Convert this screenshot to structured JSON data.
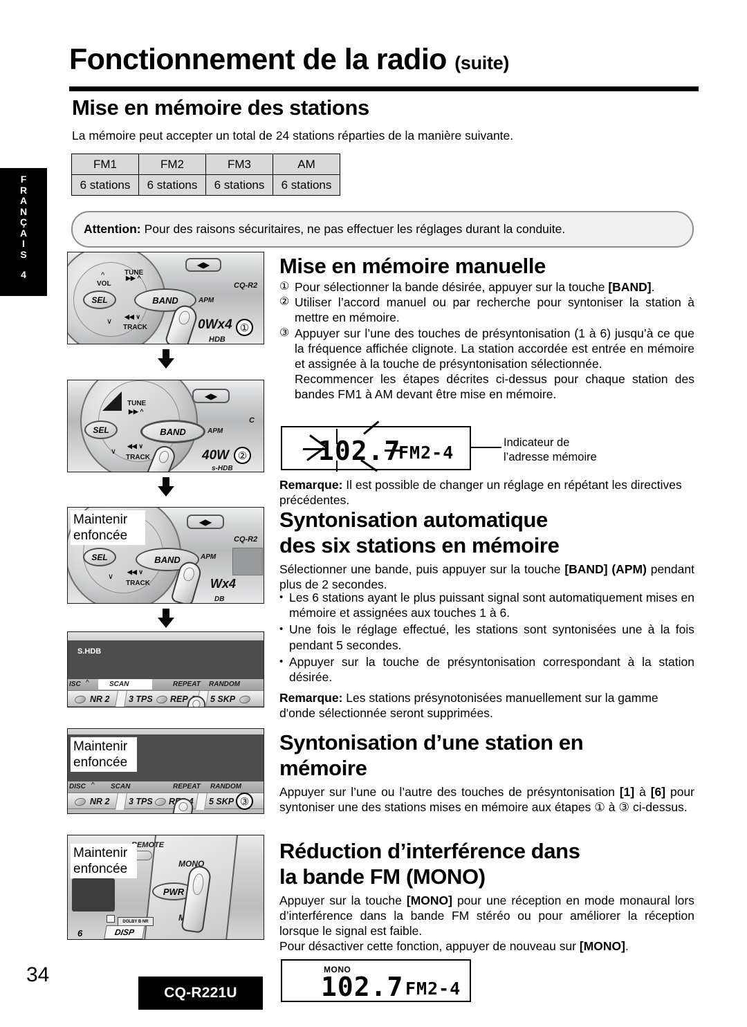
{
  "side_tab": {
    "letters": [
      "F",
      "R",
      "A",
      "N",
      "Ç",
      "A",
      "I",
      "S"
    ],
    "number": "4"
  },
  "header": {
    "title_main": "Fonctionnement de la radio",
    "title_suffix": "(suite)"
  },
  "sections": {
    "stations_memory": {
      "heading": "Mise en mémoire des stations",
      "intro": "La mémoire peut accepter un total de 24 stations réparties de la manière suivante.",
      "table": {
        "headers": [
          "FM1",
          "FM2",
          "FM3",
          "AM"
        ],
        "row": [
          "6 stations",
          "6 stations",
          "6 stations",
          "6 stations"
        ]
      },
      "attention_label": "Attention:",
      "attention_text": "Pour des raisons sécuritaires, ne pas effectuer les réglages durant la conduite."
    },
    "manual_memory": {
      "heading": "Mise en mémoire manuelle",
      "steps": [
        {
          "mark": "①",
          "text_pre": "Pour sélectionner la bande désirée, appuyer sur la touche ",
          "bold": "[BAND]",
          "text_post": "."
        },
        {
          "mark": "②",
          "text_pre": "Utiliser l’accord manuel ou par recherche pour syntoniser la station à mettre en mémoire.",
          "bold": "",
          "text_post": ""
        },
        {
          "mark": "③",
          "text_pre": "Appuyer sur l’une des touches de présyntonisation  (1 à 6) jusqu’à ce que la fréquence affichée clignote. La station accordée est entrée en mémoire et assignée à la touche de présyntonisation sélectionnée.",
          "bold": "",
          "text_post": ""
        }
      ],
      "step3_extra": "Recommencer les étapes décrites ci-dessus pour chaque station des bandes FM1 à AM devant être mise en mémoire.",
      "lcd": {
        "frequency": "102.7",
        "band_address": "FM2-4",
        "blinking": true
      },
      "lcd_caption": "Indicateur de\nl’adresse mémoire",
      "remark_label": "Remarque:",
      "remark_text": "Il est possible de changer un réglage en répétant les directives précédentes."
    },
    "auto_memory": {
      "heading_line1": "Syntonisation automatique",
      "heading_line2": "des six stations en mémoire",
      "intro_pre": "Sélectionner une bande, puis appuyer sur la touche ",
      "intro_bold1": "[BAND]",
      "intro_bold2": "(APM)",
      "intro_post": " pendant plus de 2 secondes.",
      "bullets": [
        "Les 6 stations ayant le plus puissant signal sont automatiquement mises en mémoire et assignées aux touches 1 à 6.",
        "Une fois le réglage effectué, les stations sont syntonisées une à la fois pendant 5 secondes.",
        "Appuyer sur la touche de présyntonisation correspondant à la station désirée."
      ],
      "remark_label": "Remarque:",
      "remark_text": "Les stations présynotonisées manuellement sur la gamme d'onde sélectionnée seront supprimées."
    },
    "recall_station": {
      "heading_line1": "Syntonisation d’une station en",
      "heading_line2": "mémoire",
      "text_parts": [
        "Appuyer sur l’une ou l’autre des touches de présyntonisation ",
        "[1]",
        " à ",
        "[6]",
        " pour syntoniser une des stations mises en mémoire aux étapes ",
        "①",
        " à ",
        "③",
        " ci-dessus."
      ]
    },
    "mono_reduction": {
      "heading_line1": "Réduction d’interférence dans",
      "heading_line2": "la bande FM (MONO)",
      "para1_pre": "Appuyer sur la touche ",
      "para1_bold": "[MONO]",
      "para1_post": " pour une réception en mode monaural lors d’interférence dans la bande FM stéréo ou pour améliorer la réception lorsque le signal est faible.",
      "para2_pre": "Pour désactiver cette fonction, appuyer de nouveau sur ",
      "para2_bold": "[MONO]",
      "para2_post": ".",
      "lcd": {
        "indicator": "MONO",
        "frequency": "102.7",
        "band_address": "FM2-4"
      }
    }
  },
  "illustrations": [
    {
      "id": "panel-1",
      "step_mark": "①",
      "labels": [
        "VOL",
        "TUNE",
        "SEL",
        "BAND",
        "APM",
        "TRACK",
        "CQ-R2",
        "0Wx4",
        "HDB"
      ]
    },
    {
      "id": "panel-2",
      "step_mark": "②",
      "labels": [
        "TUNE",
        "SEL",
        "BAND",
        "APM",
        "TRACK",
        "40W",
        "C",
        "s-HDB"
      ]
    },
    {
      "id": "panel-3",
      "step_mark": "",
      "callout": "Maintenir\nenfoncée",
      "labels": [
        "SEL",
        "BAND",
        "APM",
        "TRACK",
        "CQ-R2",
        "Wx4",
        "DB"
      ]
    },
    {
      "id": "panel-4",
      "step_mark": "",
      "display_text": "S.HDB",
      "labels": [
        "ISC",
        "SCAN",
        "REPEAT",
        "RANDOM",
        "NR 2",
        "3 TPS",
        "REP 4",
        "5 SKP"
      ]
    },
    {
      "id": "panel-5",
      "step_mark": "③",
      "callout": "Maintenir\nenfoncée",
      "labels": [
        "DISC",
        "SCAN",
        "REPEAT",
        "RANDOM",
        "NR 2",
        "3 TPS",
        "REP 4",
        "5 SKP"
      ]
    },
    {
      "id": "panel-6",
      "step_mark": "",
      "callout": "Maintenir\nenfoncée",
      "labels": [
        "REMOTE",
        "MONO",
        "PWR",
        "MODE",
        "DOLBY B NR",
        "6",
        "DISP"
      ]
    }
  ],
  "footer": {
    "page_number": "34",
    "model": "CQ-R221U"
  }
}
